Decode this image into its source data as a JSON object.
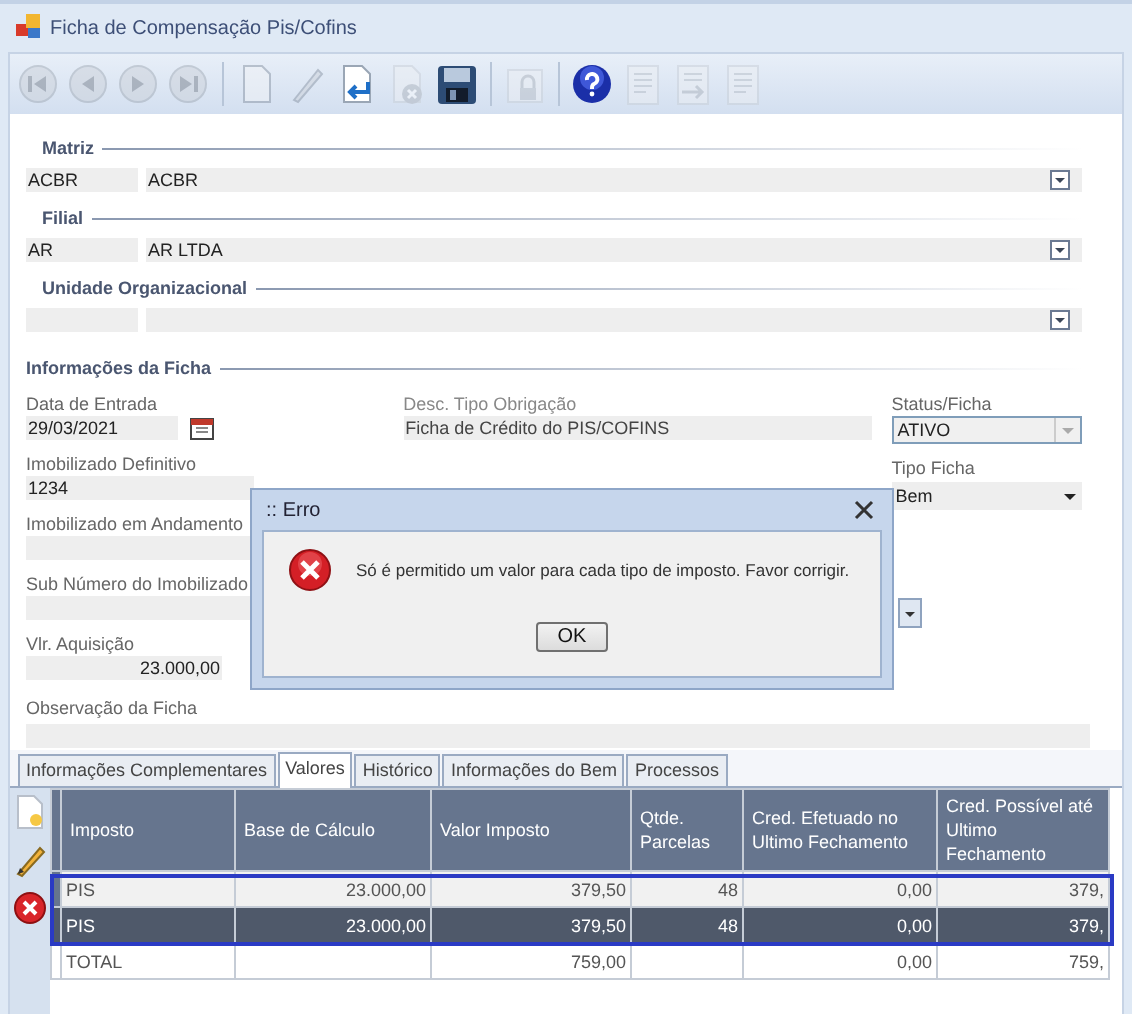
{
  "window": {
    "title": "Ficha de Compensação Pis/Cofins"
  },
  "toolbar": [
    {
      "kind": "first",
      "disabled": true
    },
    {
      "kind": "previous",
      "disabled": true
    },
    {
      "kind": "next",
      "disabled": true
    },
    {
      "kind": "last",
      "disabled": true
    },
    {
      "kind": "separator"
    },
    {
      "kind": "new",
      "disabled": true
    },
    {
      "kind": "edit",
      "disabled": true
    },
    {
      "kind": "undo",
      "disabled": false
    },
    {
      "kind": "delete",
      "disabled": true
    },
    {
      "kind": "save",
      "disabled": false
    },
    {
      "kind": "separator"
    },
    {
      "kind": "lock",
      "disabled": true
    },
    {
      "kind": "separator"
    },
    {
      "kind": "help",
      "disabled": false
    },
    {
      "kind": "report",
      "disabled": true
    },
    {
      "kind": "export",
      "disabled": true
    },
    {
      "kind": "report",
      "disabled": true
    }
  ],
  "lookups": [
    {
      "title": "Matriz",
      "code": "ACBR",
      "name": "ACBR"
    },
    {
      "title": "Filial",
      "code": "AR",
      "name": "AR LTDA"
    },
    {
      "title": "Unidade Organizacional"
    }
  ],
  "ficha": {
    "title": "Informações da Ficha",
    "data_entrada": {
      "label": "Data de Entrada",
      "value": "29/03/2021"
    },
    "desc_tipo": {
      "label": "Desc. Tipo Obrigação",
      "value": "Ficha de Crédito do PIS/COFINS"
    },
    "status": {
      "label": "Status/Ficha",
      "value": "ATIVO",
      "disabled": true
    },
    "imob_definitivo": {
      "label": "Imobilizado Definitivo",
      "value": "1234"
    },
    "tipo_ficha": {
      "label": "Tipo Ficha",
      "value": "Bem",
      "disabled": false
    },
    "imob_andamento": {
      "label": "Imobilizado em Andamento"
    },
    "sub_numero": {
      "label": "Sub Número do Imobilizado"
    },
    "vlr_aquisicao": {
      "label": "Vlr. Aquisição",
      "value": "23.000,00"
    },
    "observacao": {
      "label": "Observação da Ficha"
    }
  },
  "tabs": [
    {
      "label": "Informações Complementares",
      "selected": false
    },
    {
      "label": "Valores",
      "selected": true
    },
    {
      "label": "Histórico",
      "selected": false
    },
    {
      "label": "Informações do Bem",
      "selected": false
    },
    {
      "label": "Processos",
      "selected": false
    }
  ],
  "grid_tools": [
    {
      "kind": "new"
    },
    {
      "kind": "edit"
    },
    {
      "kind": "delete"
    }
  ],
  "table": {
    "columns": [
      "Imposto",
      "Base de Cálculo",
      "Valor Imposto",
      "Qtde. Parcelas",
      "Cred. Efetuado no Ultimo Fechamento",
      "Cred. Possível até Ultimo Fechamento"
    ],
    "rows": [
      {
        "cells": [
          "PIS",
          "23.000,00",
          "379,50",
          "48",
          "0,00",
          "379,"
        ],
        "selected": false
      },
      {
        "cells": [
          "PIS",
          "23.000,00",
          "379,50",
          "48",
          "0,00",
          "379,"
        ],
        "selected": true
      }
    ],
    "total": {
      "label": "TOTAL",
      "valor_imposto": "759,00",
      "cred_efetuado": "0,00",
      "cred_possivel": "759,"
    }
  },
  "dialog": {
    "title": ":: Erro",
    "message": "Só é permitido um valor para cada tipo de imposto. Favor corrigir.",
    "button": "OK"
  }
}
